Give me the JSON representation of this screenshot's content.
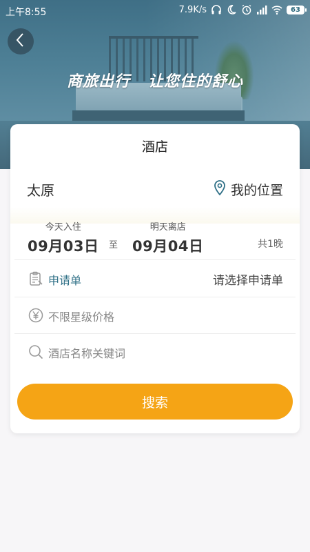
{
  "status_bar": {
    "time": "上午8:55",
    "net_speed": "7.9K/s",
    "battery": "63"
  },
  "hero": {
    "slogan": "商旅出行   让您住的舒心"
  },
  "card": {
    "title": "酒店",
    "city": "太原",
    "location_label": "我的位置",
    "checkin_hint": "今天入住",
    "checkin_date": "09月03日",
    "to_label": "至",
    "checkout_hint": "明天离店",
    "checkout_date": "09月04日",
    "nights": "共1晚",
    "request_label": "申请单",
    "request_value": "请选择申请单",
    "star_price_label": "不限星级价格",
    "keyword_placeholder": "酒店名称关键词",
    "search_label": "搜索"
  },
  "colors": {
    "accent": "#f5a415",
    "link": "#2e6f86",
    "hero": "#4d7f95"
  },
  "icons": [
    "back-icon",
    "headphones-icon",
    "moon-icon",
    "alarm-icon",
    "signal-icon",
    "wifi-icon",
    "battery-icon",
    "location-pin-icon",
    "clipboard-icon",
    "yen-icon",
    "search-icon"
  ]
}
